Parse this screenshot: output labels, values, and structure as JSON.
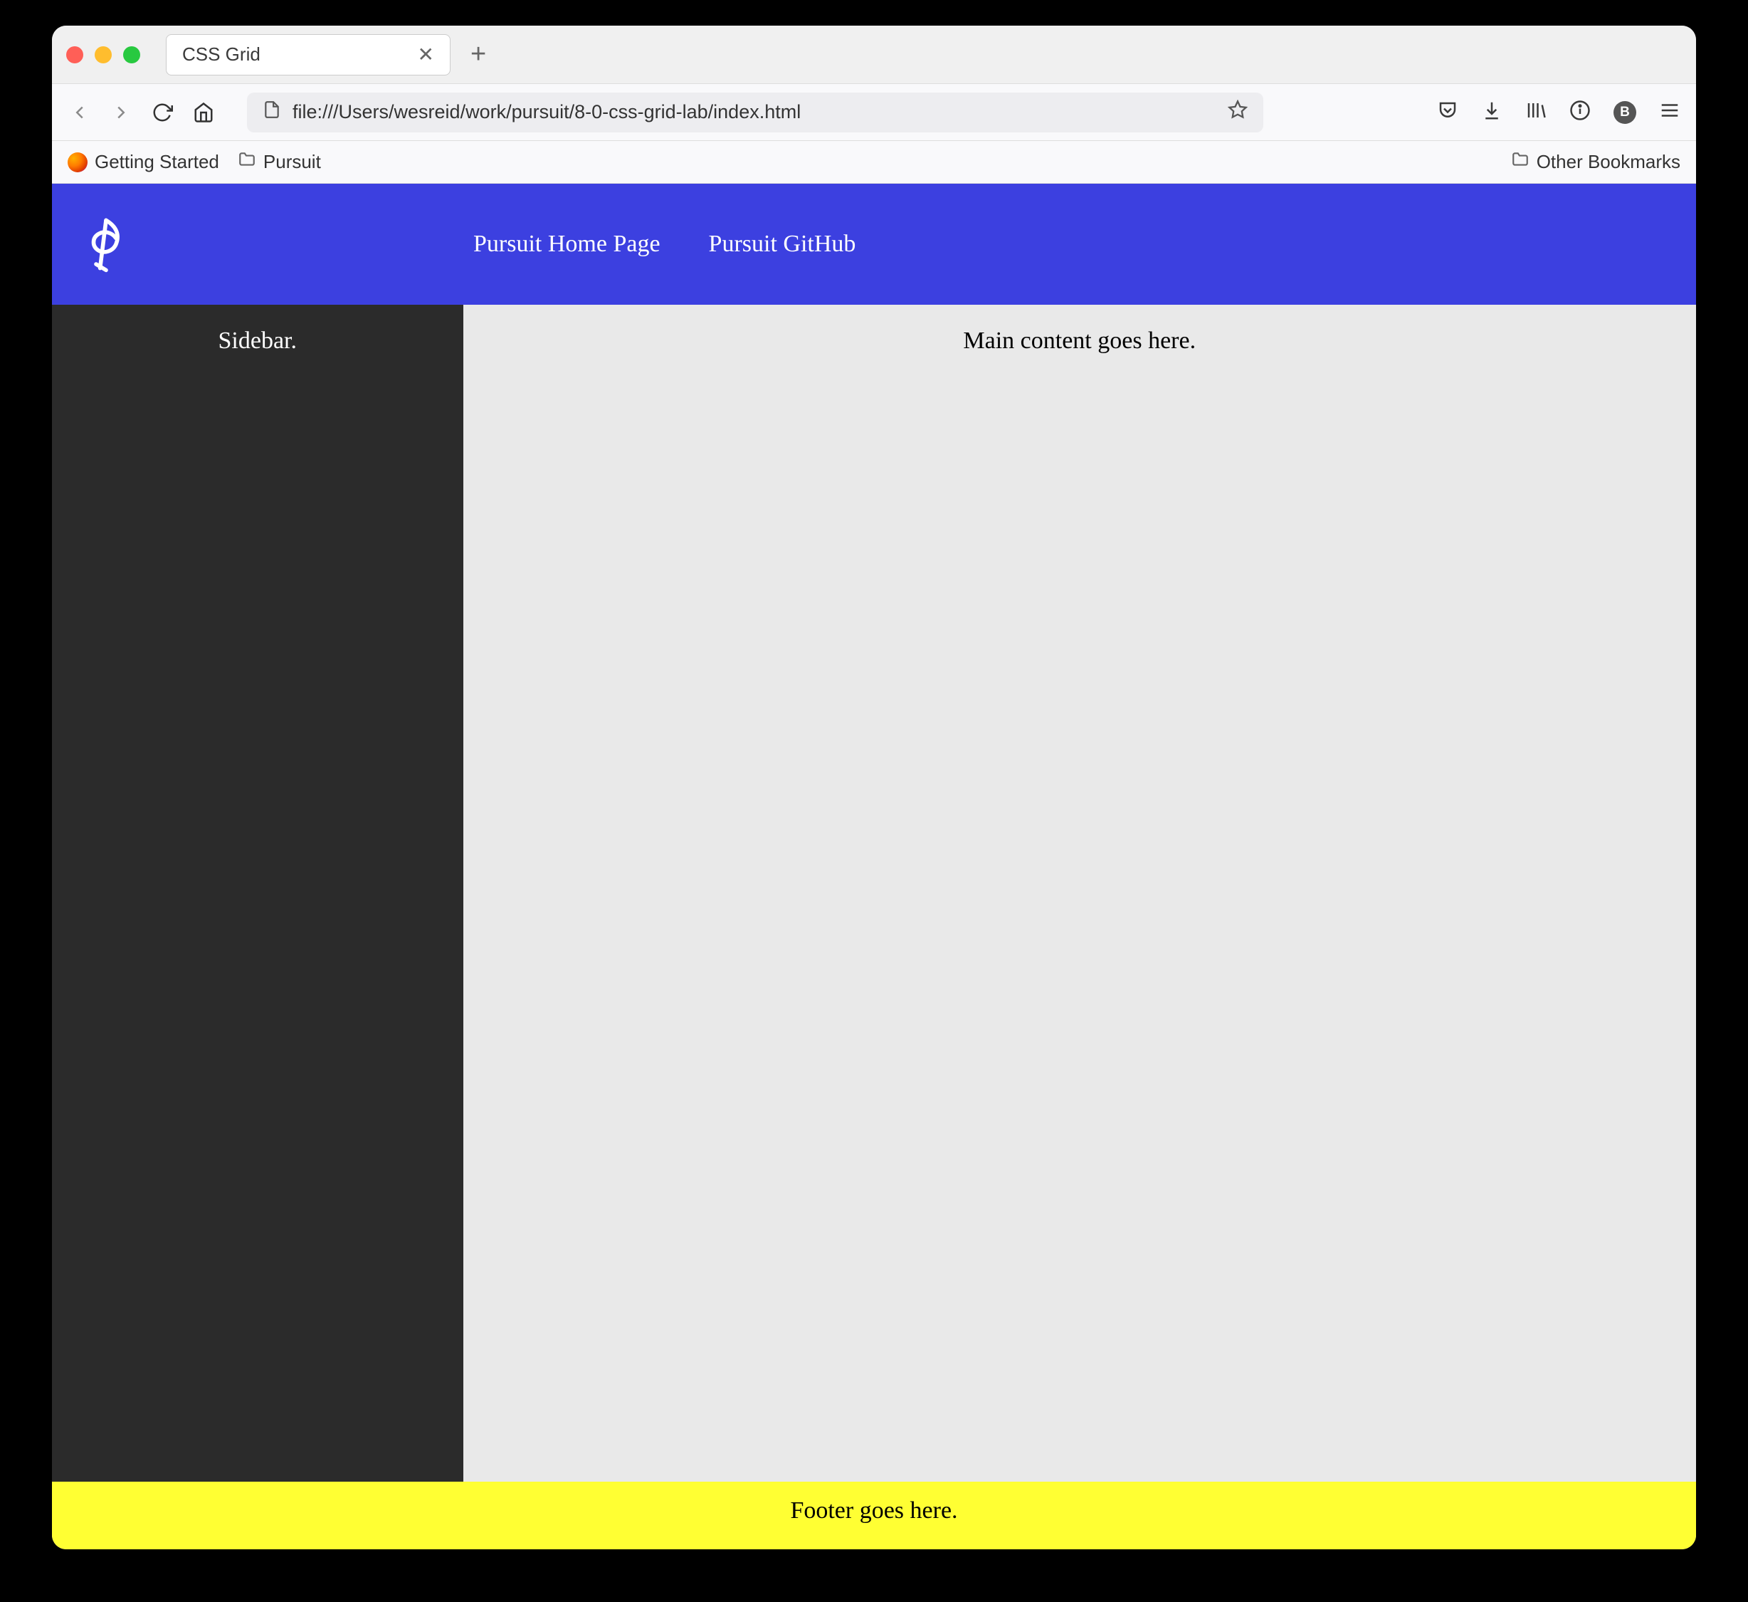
{
  "browser": {
    "tab_title": "CSS Grid",
    "url": "file:///Users/wesreid/work/pursuit/8-0-css-grid-lab/index.html",
    "bookmarks": {
      "getting_started": "Getting Started",
      "pursuit": "Pursuit",
      "other": "Other Bookmarks"
    },
    "avatar_initial": "B"
  },
  "page": {
    "nav": {
      "home": "Pursuit Home Page",
      "github": "Pursuit GitHub"
    },
    "sidebar_text": "Sidebar.",
    "main_text": "Main content goes here.",
    "footer_text": "Footer goes here."
  }
}
